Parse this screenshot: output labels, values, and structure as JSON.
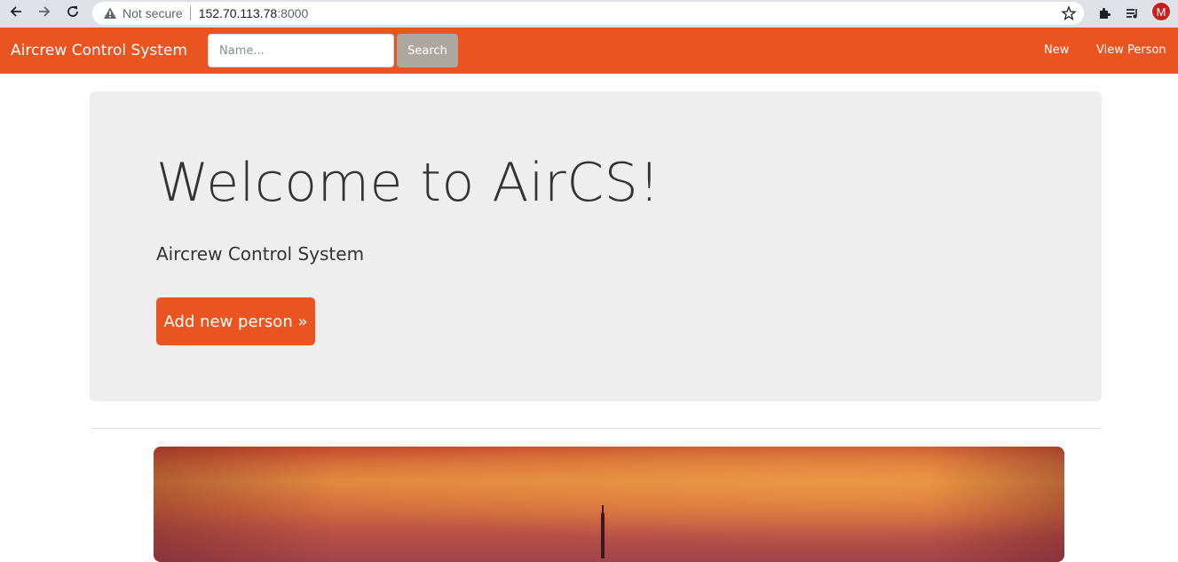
{
  "browser": {
    "security_label": "Not secure",
    "url_host": "152.70.113.78",
    "url_port": ":8000",
    "profile_initial": "M"
  },
  "navbar": {
    "brand": "Aircrew Control System",
    "search_placeholder": "Name...",
    "search_button": "Search",
    "links": [
      "New",
      "View Person"
    ],
    "color": "#e95420"
  },
  "jumbotron": {
    "title": "Welcome to AirCS!",
    "subtitle": "Aircrew Control System",
    "button": "Add new person »"
  },
  "colors": {
    "accent": "#e95420",
    "secondary": "#aea79f",
    "jumbotron_bg": "#eeeeee"
  },
  "icons": [
    "back-arrow-icon",
    "forward-arrow-icon",
    "reload-icon",
    "warning-icon",
    "star-icon",
    "puzzle-icon",
    "media-queue-icon"
  ]
}
